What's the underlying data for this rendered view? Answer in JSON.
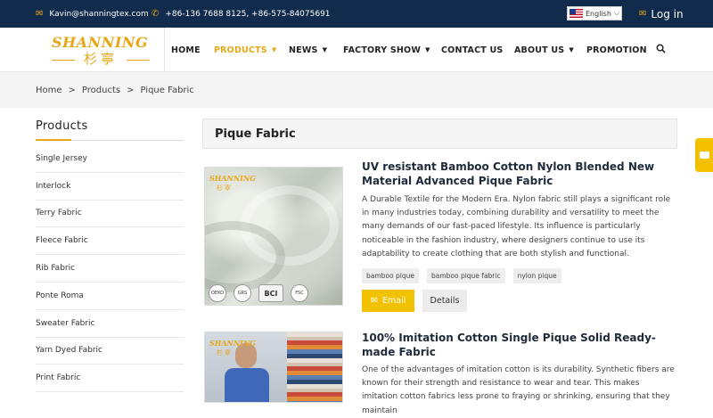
{
  "topbar": {
    "email": "Kavin@shanningtex.com",
    "email_icon": "envelope-icon",
    "phone": "+86-136 7688 8125, +86-575-84075691",
    "phone_icon": "phone-icon",
    "language": "English",
    "login": "Log in",
    "login_icon": "envelope-icon"
  },
  "logo": {
    "text": "SHANNING",
    "chinese": "杉寧"
  },
  "nav": {
    "home": "HOME",
    "products": "PRODUCTS",
    "news": "NEWS",
    "factory_show": "FACTORY SHOW",
    "contact_us": "CONTACT US",
    "about_us": "ABOUT US",
    "promotion": "PROMOTION",
    "caret": "▼",
    "active": "products"
  },
  "breadcrumb": {
    "home": "Home",
    "sep": ">",
    "products": "Products",
    "current": "Pique Fabric"
  },
  "sidebar": {
    "title": "Products",
    "items": [
      {
        "label": "Single Jersey"
      },
      {
        "label": "Interlock"
      },
      {
        "label": "Terry Fabric"
      },
      {
        "label": "Fleece Fabric"
      },
      {
        "label": "Rib Fabric"
      },
      {
        "label": "Ponte Roma"
      },
      {
        "label": "Sweater Fabric"
      },
      {
        "label": "Yarn Dyed Fabric"
      },
      {
        "label": "Print Fabric"
      }
    ]
  },
  "main": {
    "heading": "Pique Fabric",
    "products": [
      {
        "title": "UV resistant Bamboo Cotton Nylon Blended New Material Advanced Pique Fabric",
        "description": "A Durable Textile for the Modern Era. Nylon fabric still plays a significant role in many industries today, combining durability and versatility to meet the many demands of our fast-paced lifestyle. Its influence is particularly noticeable in the fashion industry, where designers continue to use its adaptability to create clothing that are both stylish and functional.",
        "tags": [
          "bamboo pique",
          "bamboo pique fabric",
          "nylon pique"
        ],
        "email_label": "Email",
        "details_label": "Details",
        "image_watermark": "SHANNING",
        "image_watermark_cn": "杉寧",
        "cert_labels": [
          "OEKO",
          "GRS",
          "BCI",
          "FSC"
        ]
      },
      {
        "title": "100% Imitation Cotton Single Pique Solid Ready-made Fabric",
        "description": "One of the advantages of imitation cotton is its durability. Synthetic fibers are known for their strength and resistance to wear and tear. This makes imitation cotton fabrics less prone to fraying or shrinking, ensuring that they maintain"
      }
    ]
  },
  "colors": {
    "topbar_bg": "#102b4c",
    "accent": "#e6a817",
    "email_button": "#f2c100"
  },
  "floating": {
    "chat_icon": "chat-icon"
  }
}
